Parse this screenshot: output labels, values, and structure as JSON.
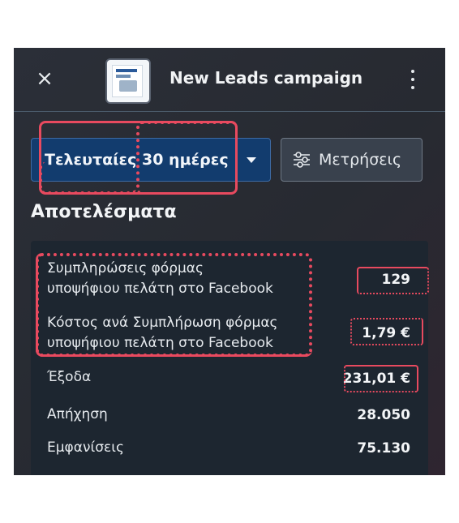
{
  "header": {
    "title": "New Leads campaign",
    "close_icon": "close-icon",
    "more_icon": "more-vertical-icon"
  },
  "filters": {
    "date_range_label": "Τελευταίες 30 ημέρες",
    "metrics_label": "Μετρήσεις",
    "metrics_icon": "sliders-icon"
  },
  "results": {
    "heading": "Αποτελέσματα",
    "rows": [
      {
        "label_line1": "Συμπληρώσεις φόρμας",
        "label_line2": "υποψήφιου πελάτη στο Facebook",
        "value": "129"
      },
      {
        "label_line1": "Κόστος ανά Συμπλήρωση φόρμας",
        "label_line2": "υποψήφιου πελάτη στο Facebook",
        "value": "1,79 €"
      },
      {
        "label_line1": "Έξοδα",
        "value": "231,01 €"
      },
      {
        "label_line1": "Απήχηση",
        "value": "28.050"
      },
      {
        "label_line1": "Εμφανίσεις",
        "value": "75.130"
      }
    ]
  },
  "colors": {
    "primary_button": "#123c6e",
    "highlight": "#e84a5f",
    "card": "#1d2630"
  }
}
